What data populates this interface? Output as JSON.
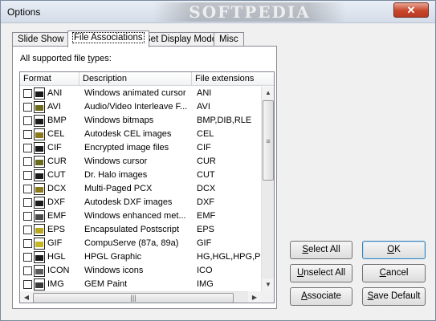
{
  "window": {
    "title": "Options",
    "watermark": "SOFTPEDIA",
    "close_glyph": "✕"
  },
  "tabs": [
    {
      "label": "Slide Show",
      "active": false
    },
    {
      "label": "File Associations",
      "active": true
    },
    {
      "label": "Set Display Mode",
      "active": false
    },
    {
      "label": "Misc",
      "active": false
    }
  ],
  "panel": {
    "label_pre": "All supported file ",
    "label_u": "t",
    "label_post": "ypes:"
  },
  "list": {
    "columns": [
      "Format",
      "Description",
      "File extensions"
    ],
    "rows": [
      {
        "format": "ANI",
        "description": "Windows animated cursor",
        "extensions": "ANI",
        "icon": "ani-file-icon",
        "icon_color": "#1a1a1a"
      },
      {
        "format": "AVI",
        "description": "Audio/Video Interleave F...",
        "extensions": "AVI",
        "icon": "avi-file-icon",
        "icon_color": "#6b6b1e"
      },
      {
        "format": "BMP",
        "description": "Windows bitmaps",
        "extensions": "BMP,DIB,RLE",
        "icon": "bmp-file-icon",
        "icon_color": "#1a1a1a"
      },
      {
        "format": "CEL",
        "description": "Autodesk CEL images",
        "extensions": "CEL",
        "icon": "cel-file-icon",
        "icon_color": "#8a7a1a"
      },
      {
        "format": "CIF",
        "description": "Encrypted image files",
        "extensions": "CIF",
        "icon": "cif-file-icon",
        "icon_color": "#1a1a1a"
      },
      {
        "format": "CUR",
        "description": "Windows cursor",
        "extensions": "CUR",
        "icon": "cur-file-icon",
        "icon_color": "#6b6b1e"
      },
      {
        "format": "CUT",
        "description": "Dr. Halo images",
        "extensions": "CUT",
        "icon": "cut-file-icon",
        "icon_color": "#1a1a1a"
      },
      {
        "format": "DCX",
        "description": "Multi-Paged PCX",
        "extensions": "DCX",
        "icon": "dcx-file-icon",
        "icon_color": "#8a7a1a"
      },
      {
        "format": "DXF",
        "description": "Autodesk DXF images",
        "extensions": "DXF",
        "icon": "dxf-file-icon",
        "icon_color": "#1a1a1a"
      },
      {
        "format": "EMF",
        "description": "Windows enhanced met...",
        "extensions": "EMF",
        "icon": "emf-file-icon",
        "icon_color": "#4a4a4a"
      },
      {
        "format": "EPS",
        "description": "Encapsulated Postscript",
        "extensions": "EPS",
        "icon": "eps-file-icon",
        "icon_color": "#b8a820"
      },
      {
        "format": "GIF",
        "description": "CompuServe (87a, 89a)",
        "extensions": "GIF",
        "icon": "gif-file-icon",
        "icon_color": "#c8b820"
      },
      {
        "format": "HGL",
        "description": "HPGL Graphic",
        "extensions": "HG,HGL,HPG,PLO,",
        "icon": "hgl-file-icon",
        "icon_color": "#1a1a1a"
      },
      {
        "format": "ICON",
        "description": "Windows icons",
        "extensions": "ICO",
        "icon": "icon-file-icon",
        "icon_color": "#5a5a5a"
      },
      {
        "format": "IMG",
        "description": "GEM Paint",
        "extensions": "IMG",
        "icon": "img-file-icon",
        "icon_color": "#3a3a3a"
      }
    ]
  },
  "buttons": {
    "select_all": {
      "u": "S",
      "rest": "elect All"
    },
    "unselect_all": {
      "u": "U",
      "rest": "nselect All"
    },
    "associate": {
      "u": "A",
      "rest": "ssociate"
    },
    "ok": {
      "u": "O",
      "rest": "K"
    },
    "cancel": {
      "u": "C",
      "rest": "ancel"
    },
    "save_default": {
      "u": "S",
      "rest": "ave Default"
    }
  }
}
